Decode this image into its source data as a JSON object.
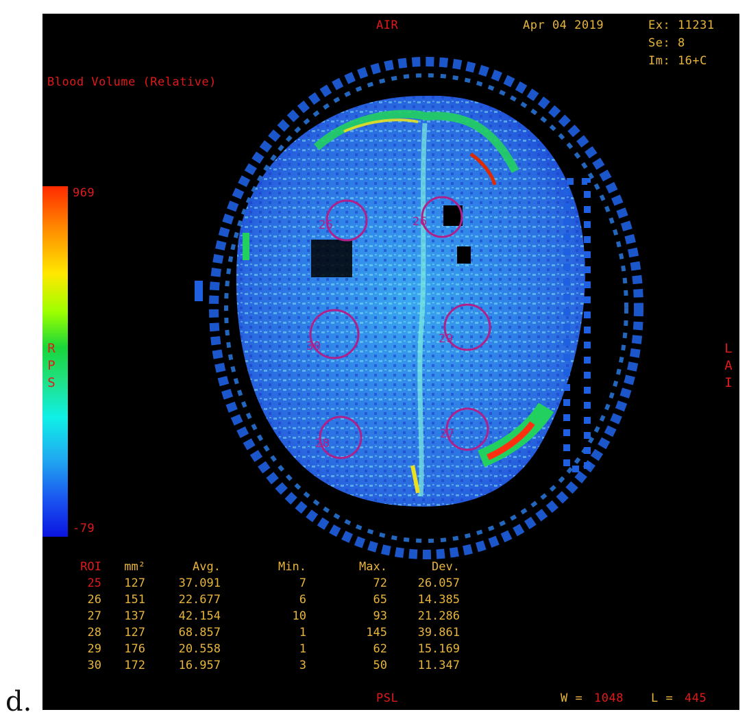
{
  "panel_label": "d.",
  "header": {
    "region": "AIR",
    "date": "Apr 04 2019",
    "exam": "Ex: 11231",
    "series": "Se: 8",
    "image": "Im: 16+C",
    "map_title": "Blood Volume (Relative)"
  },
  "color_scale": {
    "max_label": "969",
    "min_label": "-79",
    "side_letters": [
      "R",
      "P",
      "S"
    ]
  },
  "orientation_right": [
    "L",
    "A",
    "I"
  ],
  "bottom_label": "PSL",
  "window": {
    "w_label": "W =",
    "w_value": "1048",
    "l_label": "L =",
    "l_value": "445"
  },
  "roi_markers": [
    "25",
    "26",
    "30",
    "29",
    "28",
    "27"
  ],
  "roi_table": {
    "columns": [
      "ROI",
      "mm²",
      "Avg.",
      "Min.",
      "Max.",
      "Dev."
    ],
    "rows": [
      [
        "25",
        "127",
        "37.091",
        "7",
        "72",
        "26.057"
      ],
      [
        "26",
        "151",
        "22.677",
        "6",
        "65",
        "14.385"
      ],
      [
        "27",
        "137",
        "42.154",
        "10",
        "93",
        "21.286"
      ],
      [
        "28",
        "127",
        "68.857",
        "1",
        "145",
        "39.861"
      ],
      [
        "29",
        "176",
        "20.558",
        "1",
        "62",
        "15.169"
      ],
      [
        "30",
        "172",
        "16.957",
        "3",
        "50",
        "11.347"
      ]
    ]
  },
  "colors": {
    "overlay_red": "#e01a1a",
    "overlay_yellow": "#e8b53c",
    "roi_circle": "#b0208a",
    "background": "#000000"
  }
}
